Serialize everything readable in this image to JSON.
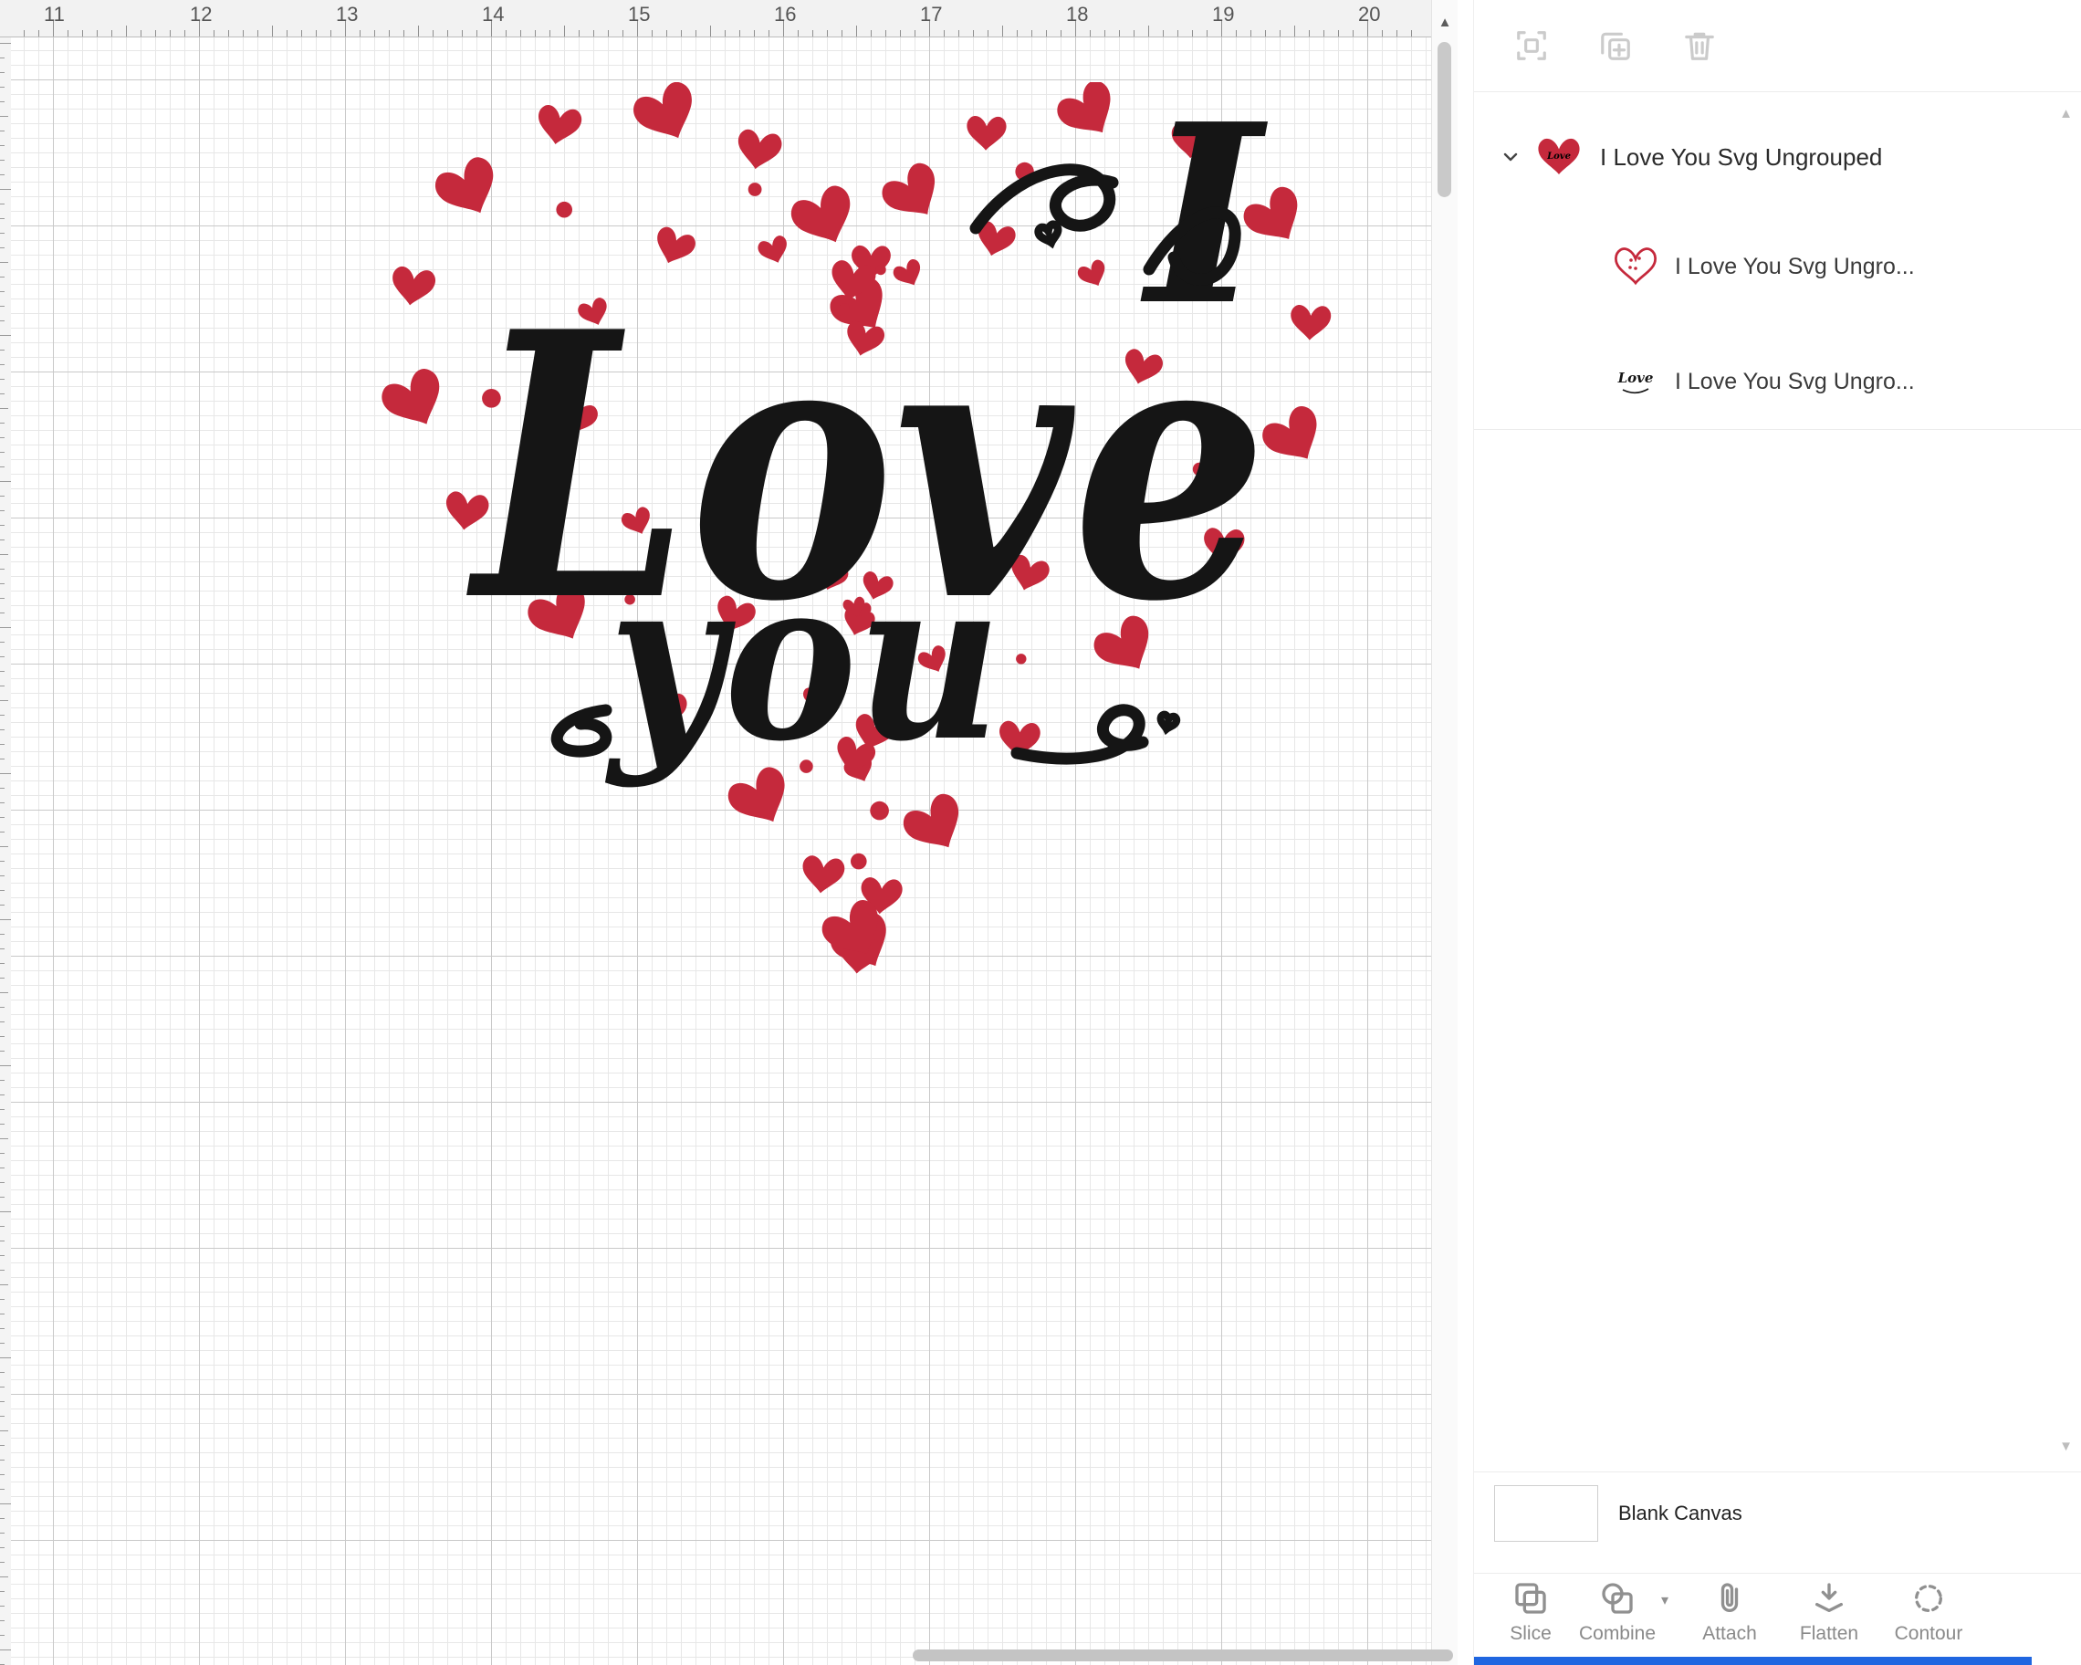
{
  "colors": {
    "heart_red": "#c5293c",
    "artwork_black": "#151515",
    "accent_blue": "#1f66e0"
  },
  "ruler": {
    "numbers": [
      "11",
      "12",
      "13",
      "14",
      "15",
      "16",
      "17",
      "18",
      "19",
      "20"
    ]
  },
  "canvas": {
    "artwork_line1": "Love",
    "artwork_line2": "you",
    "artwork_letter": "I"
  },
  "panel": {
    "layers": {
      "root": {
        "label": "I Love You Svg Ungrouped"
      },
      "children": [
        {
          "label": "I Love You Svg Ungro..."
        },
        {
          "label": "I Love You Svg Ungro..."
        }
      ]
    },
    "canvas_row": {
      "label": "Blank Canvas"
    },
    "toolbar": [
      {
        "label": "Slice"
      },
      {
        "label": "Combine"
      },
      {
        "label": "Attach"
      },
      {
        "label": "Flatten"
      },
      {
        "label": "Contour"
      }
    ]
  }
}
